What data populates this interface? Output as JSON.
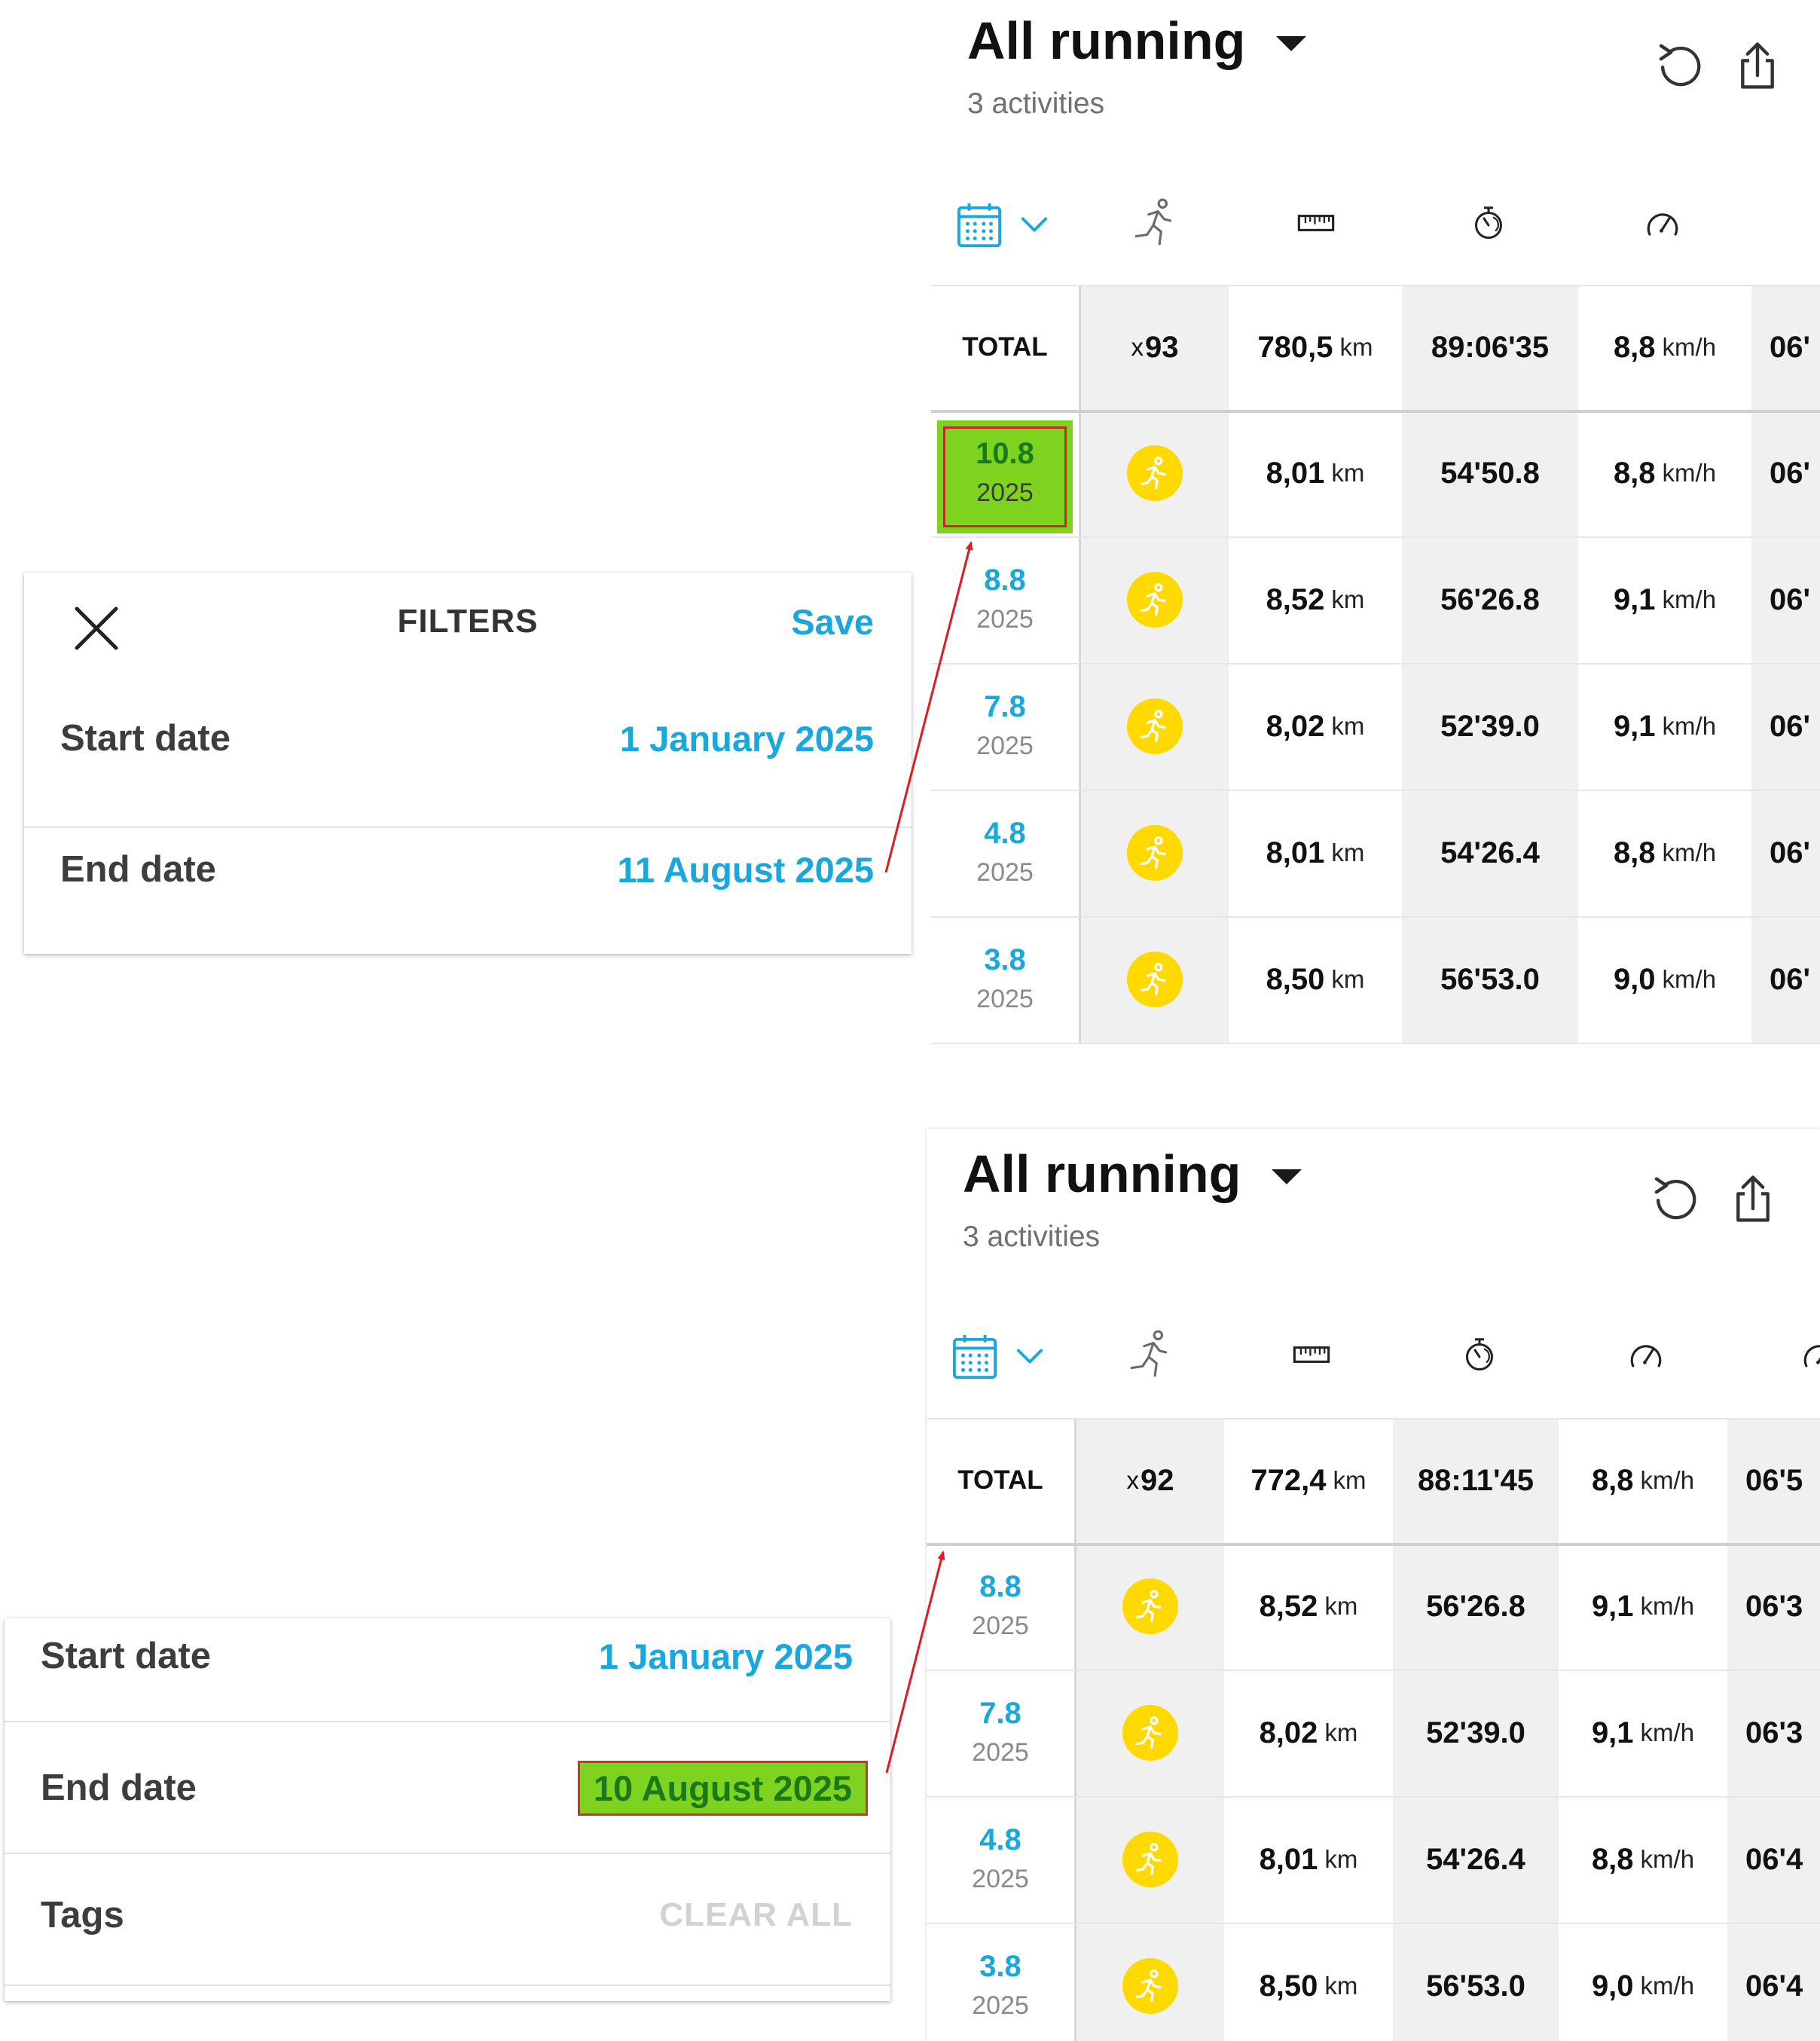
{
  "colors": {
    "accent_blue": "#1aa7de",
    "highlight_green": "#7ed321",
    "highlight_border_red": "#c62828",
    "arrow_red": "#e11b1b",
    "run_badge_yellow": "#ffd900",
    "column_shade": "#f0f0f0"
  },
  "icons": {
    "close": "close-icon",
    "refresh": "refresh-icon",
    "share": "share-icon",
    "calendar": "calendar-icon",
    "chevron": "chevron-down-icon",
    "activity": "running-person-icon",
    "distance": "ruler-icon",
    "duration": "stopwatch-icon",
    "speed": "speedometer-icon",
    "run_badge": "running-badge-icon"
  },
  "filters_top": {
    "title": "FILTERS",
    "save_label": "Save",
    "start_label": "Start date",
    "start_value": "1 January 2025",
    "end_label": "End date",
    "end_value": "11 August 2025"
  },
  "filters_bottom": {
    "start_label": "Start date",
    "start_value": "1 January 2025",
    "end_label": "End date",
    "end_value": "10 August 2025",
    "tags_label": "Tags",
    "clear_all_label": "CLEAR ALL"
  },
  "screen_top": {
    "title": "All running",
    "subtitle": "3 activities",
    "total": {
      "label": "TOTAL",
      "count_prefix": "x",
      "count": "93",
      "distance": "780,5",
      "distance_unit": "km",
      "duration": "89:06'35",
      "speed": "8,8",
      "speed_unit": "km/h",
      "extra": "06'"
    },
    "rows": [
      {
        "day": "10.8",
        "year": "2025",
        "distance": "8,01",
        "distance_unit": "km",
        "duration": "54'50.8",
        "speed": "8,8",
        "speed_unit": "km/h",
        "extra": "06'"
      },
      {
        "day": "8.8",
        "year": "2025",
        "distance": "8,52",
        "distance_unit": "km",
        "duration": "56'26.8",
        "speed": "9,1",
        "speed_unit": "km/h",
        "extra": "06'"
      },
      {
        "day": "7.8",
        "year": "2025",
        "distance": "8,02",
        "distance_unit": "km",
        "duration": "52'39.0",
        "speed": "9,1",
        "speed_unit": "km/h",
        "extra": "06'"
      },
      {
        "day": "4.8",
        "year": "2025",
        "distance": "8,01",
        "distance_unit": "km",
        "duration": "54'26.4",
        "speed": "8,8",
        "speed_unit": "km/h",
        "extra": "06'"
      },
      {
        "day": "3.8",
        "year": "2025",
        "distance": "8,50",
        "distance_unit": "km",
        "duration": "56'53.0",
        "speed": "9,0",
        "speed_unit": "km/h",
        "extra": "06'"
      }
    ]
  },
  "screen_bottom": {
    "title": "All running",
    "subtitle": "3 activities",
    "total": {
      "label": "TOTAL",
      "count_prefix": "x",
      "count": "92",
      "distance": "772,4",
      "distance_unit": "km",
      "duration": "88:11'45",
      "speed": "8,8",
      "speed_unit": "km/h",
      "extra": "06'5"
    },
    "rows": [
      {
        "day": "8.8",
        "year": "2025",
        "distance": "8,52",
        "distance_unit": "km",
        "duration": "56'26.8",
        "speed": "9,1",
        "speed_unit": "km/h",
        "extra": "06'3"
      },
      {
        "day": "7.8",
        "year": "2025",
        "distance": "8,02",
        "distance_unit": "km",
        "duration": "52'39.0",
        "speed": "9,1",
        "speed_unit": "km/h",
        "extra": "06'3"
      },
      {
        "day": "4.8",
        "year": "2025",
        "distance": "8,01",
        "distance_unit": "km",
        "duration": "54'26.4",
        "speed": "8,8",
        "speed_unit": "km/h",
        "extra": "06'4"
      },
      {
        "day": "3.8",
        "year": "2025",
        "distance": "8,50",
        "distance_unit": "km",
        "duration": "56'53.0",
        "speed": "9,0",
        "speed_unit": "km/h",
        "extra": "06'4"
      }
    ]
  }
}
